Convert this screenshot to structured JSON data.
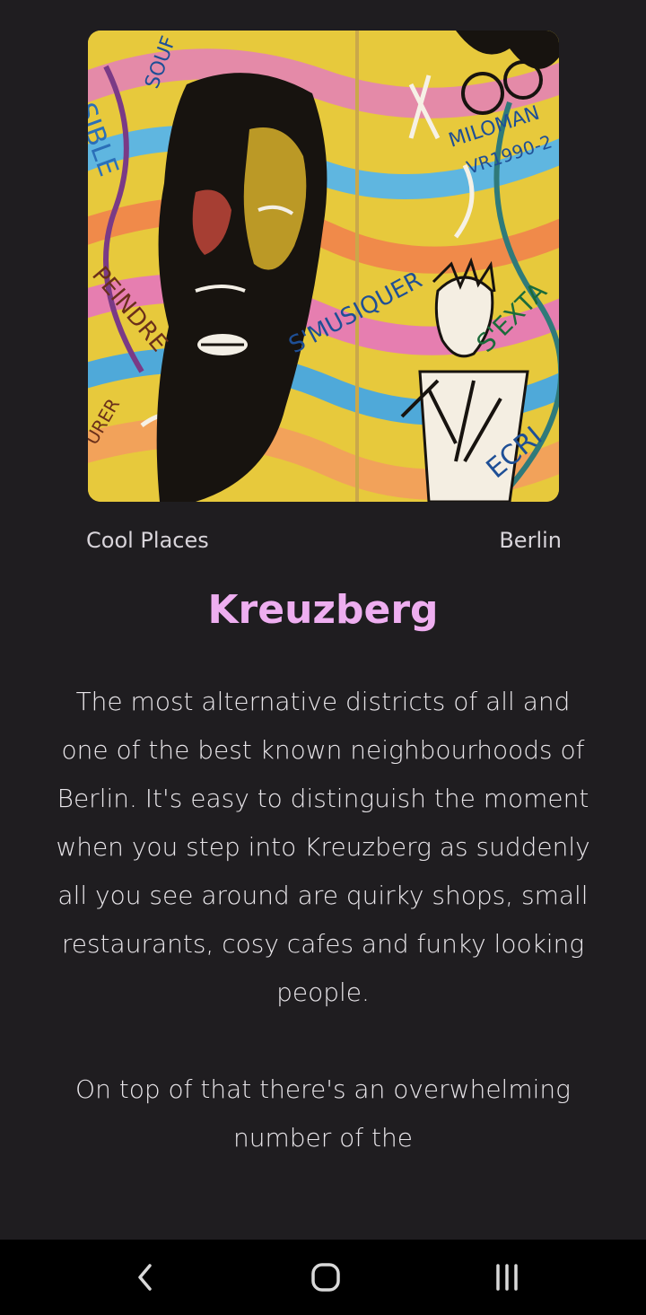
{
  "hero": {
    "alt": "Graffiti mural with a painted face",
    "mural_words": [
      "SIBLE",
      "SOUF",
      "PEINDRE",
      "URER",
      "S'MUSIQUER",
      "MILOMAN",
      "VR1990-2",
      "S'EXTA",
      "ECRI"
    ]
  },
  "meta": {
    "category": "Cool Places",
    "city": "Berlin"
  },
  "title": "Kreuzberg",
  "paragraphs": [
    "The most alternative districts of all and one of the best known neighbourhoods of Berlin. It's easy to distinguish the moment when you step into Kreuzberg as suddenly all you see around are quirky shops, small restaurants, cosy cafes and funky looking people.",
    "On top of that there's an overwhelming number of the"
  ],
  "navigation": {
    "back_icon": "chevron-left-icon",
    "home_icon": "home-rounded-square-icon",
    "recents_icon": "recents-bars-icon"
  },
  "colors": {
    "background": "#1f1d20",
    "title": "#eeaef0",
    "text": "#e9e6ea",
    "nav_bar": "#000000"
  }
}
